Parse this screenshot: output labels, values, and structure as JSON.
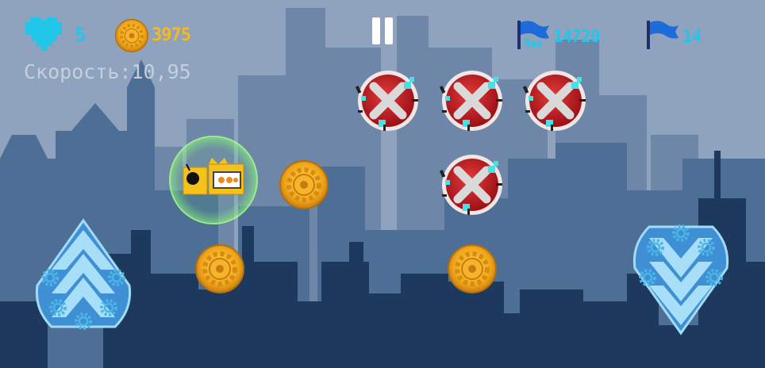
{
  "hud": {
    "lives": "5",
    "coins": "3975",
    "speed": "Скорость:10,95",
    "max_label": "Max",
    "max_distance": "14720",
    "distance": "14"
  },
  "colors": {
    "sky": "#8fa3bf",
    "hud_blue": "#22c6e8",
    "coin_gold": "#f4b820",
    "obstacle_red": "#c8202a"
  },
  "icons": [
    "heart-icon",
    "coin-icon",
    "pause-icon",
    "flag-icon",
    "up-arrow-icon",
    "down-arrow-icon",
    "x-mark-icon",
    "gear-icon"
  ]
}
